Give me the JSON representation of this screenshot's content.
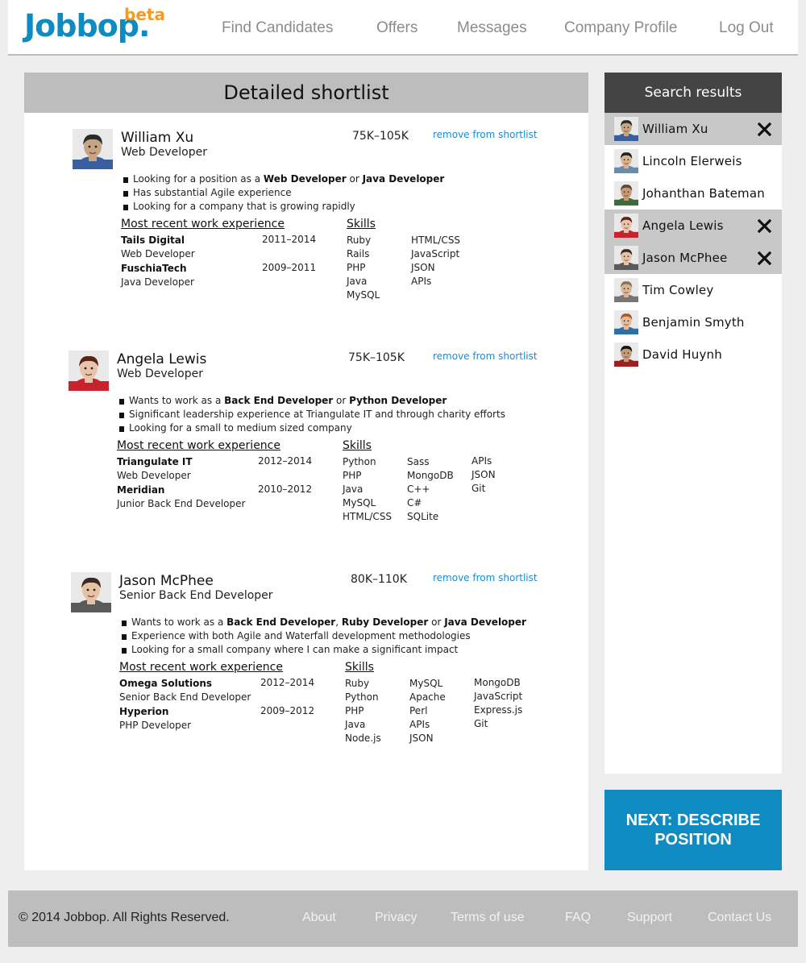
{
  "brand": {
    "name": "Jobbop.",
    "badge": "beta",
    "color": "#0f8bc2",
    "badge_color": "#f29b2b"
  },
  "nav": {
    "find_candidates": "Find Candidates",
    "offers": "Offers",
    "messages": "Messages",
    "company_profile": "Company Profile",
    "log_out": "Log Out"
  },
  "main": {
    "title": "Detailed shortlist",
    "experience_heading": "Most recent work experience",
    "skills_heading": "Skills",
    "remove_label": "remove from shortlist",
    "candidates": [
      {
        "name": "William Xu",
        "title": "Web Developer",
        "salary": "75K–105K",
        "bullets": [
          [
            "Looking for a position as a ",
            {
              "b": "Web Developer"
            },
            " or ",
            {
              "b": "Java Developer"
            }
          ],
          [
            "Has substantial Agile experience"
          ],
          [
            "Looking for a company that is growing rapidly"
          ]
        ],
        "jobs": [
          {
            "company": "Tails Digital",
            "years": "2011–2014",
            "role": "Web Developer"
          },
          {
            "company": "FuschiaTech",
            "years": "2009–2011",
            "role": "Java Developer"
          }
        ],
        "skills": [
          [
            "Ruby",
            "Rails",
            "PHP",
            "Java",
            "MySQL"
          ],
          [
            "HTML/CSS",
            "JavaScript",
            "JSON",
            "APIs"
          ]
        ]
      },
      {
        "name": "Angela Lewis",
        "title": "Web Developer",
        "salary": "75K–105K",
        "bullets": [
          [
            "Wants to work as a ",
            {
              "b": "Back End Developer"
            },
            " or ",
            {
              "b": "Python Developer"
            }
          ],
          [
            "Significant leadership experience at Triangulate IT and through charity efforts"
          ],
          [
            "Looking for a small to medium sized company"
          ]
        ],
        "jobs": [
          {
            "company": "Triangulate IT",
            "years": "2012–2014",
            "role": "Web Developer"
          },
          {
            "company": "Meridian",
            "years": "2010–2012",
            "role": "Junior Back End Developer"
          }
        ],
        "skills": [
          [
            "Python",
            "PHP",
            "Java",
            "MySQL",
            "HTML/CSS"
          ],
          [
            "Sass",
            "MongoDB",
            "C++",
            "C#",
            "SQLite"
          ],
          [
            "APIs",
            "JSON",
            "Git"
          ]
        ]
      },
      {
        "name": "Jason McPhee",
        "title": "Senior Back End Developer",
        "salary": "80K–110K",
        "bullets": [
          [
            "Wants to work as a ",
            {
              "b": "Back End Developer"
            },
            ", ",
            {
              "b": "Ruby Developer"
            },
            " or ",
            {
              "b": "Java Developer"
            }
          ],
          [
            "Experience with both Agile and Waterfall development methodologies"
          ],
          [
            "Looking for a small company where I can make a significant impact"
          ]
        ],
        "jobs": [
          {
            "company": "Omega Solutions",
            "years": "2012–2014",
            "role": "Senior Back End Developer"
          },
          {
            "company": "Hyperion",
            "years": "2009–2012",
            "role": "PHP Developer"
          }
        ],
        "skills": [
          [
            "Ruby",
            "Python",
            "PHP",
            "Java",
            "Node.js"
          ],
          [
            "MySQL",
            "Apache",
            "Perl",
            "APIs",
            "JSON"
          ],
          [
            "MongoDB",
            "JavaScript",
            "Express.js",
            "Git"
          ]
        ]
      }
    ]
  },
  "sidebar": {
    "title": "Search results",
    "results": [
      {
        "name": "William Xu",
        "shortlisted": true
      },
      {
        "name": "Lincoln Elerweis",
        "shortlisted": false
      },
      {
        "name": "Johanthan Bateman",
        "shortlisted": false
      },
      {
        "name": "Angela Lewis",
        "shortlisted": true
      },
      {
        "name": "Jason McPhee",
        "shortlisted": true
      },
      {
        "name": "Tim Cowley",
        "shortlisted": false
      },
      {
        "name": "Benjamin Smyth",
        "shortlisted": false
      },
      {
        "name": "David Huynh",
        "shortlisted": false
      }
    ]
  },
  "next_button": {
    "line1": "NEXT: DESCRIBE",
    "line2": "POSITION"
  },
  "footer": {
    "copyright": "© 2014 Jobbop. All Rights Reserved.",
    "about": "About",
    "privacy": "Privacy",
    "terms": "Terms of use",
    "faq": "FAQ",
    "support": "Support",
    "contact": "Contact Us"
  }
}
